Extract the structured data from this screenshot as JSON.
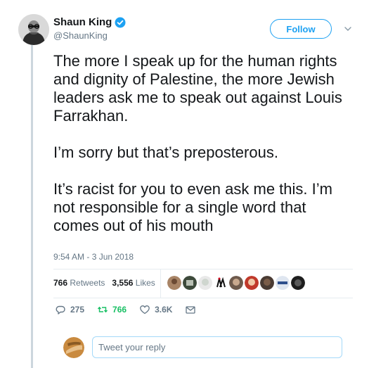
{
  "author": {
    "name": "Shaun King",
    "handle": "@ShaunKing",
    "verified": true
  },
  "follow_label": "Follow",
  "tweet": {
    "paragraphs": [
      "The more I speak up for the human rights and dignity of Palestine, the more Jewish leaders ask me to speak out against Louis Farrakhan.",
      "I’m sorry but that’s preposterous.",
      "It’s racist for you to even ask me this. I’m not responsible for a single word that comes out of his mouth"
    ],
    "timestamp": "9:54 AM - 3 Jun 2018"
  },
  "stats": {
    "retweets_count": "766",
    "retweets_label": "Retweets",
    "likes_count": "3,556",
    "likes_label": "Likes"
  },
  "actions": {
    "reply_count": "275",
    "retweet_count": "766",
    "like_count": "3.6K"
  },
  "reply": {
    "placeholder": "Tweet your reply"
  },
  "colors": {
    "accent": "#1da1f2",
    "retweet": "#17bf63",
    "muted": "#657786",
    "thread_line": "#ccd6dd"
  }
}
